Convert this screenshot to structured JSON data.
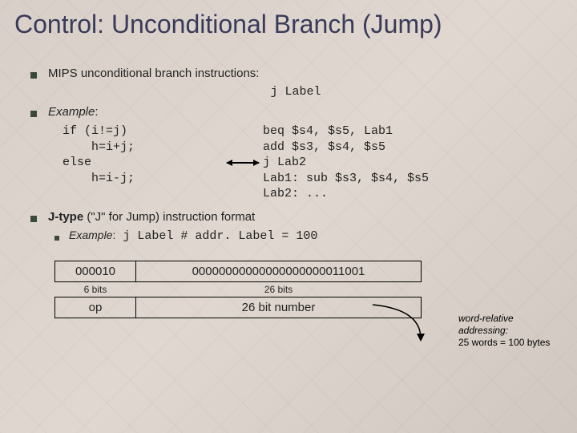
{
  "title": "Control: Unconditional Branch (Jump)",
  "bullets": {
    "b1": "MIPS unconditional branch instructions:",
    "b1_code": "j Label",
    "b2": "Example",
    "b3": "J-type",
    "b3_rest": " (\"J\" for Jump) instruction format",
    "sub": "Example",
    "sub_rest": " j Label # addr. Label = 100"
  },
  "code": {
    "left": "if (i!=j)\n    h=i+j;\nelse\n    h=i-j;",
    "right": "beq $s4, $s5, Lab1\nadd $s3, $s4, $s5\nj Lab2\nLab1: sub $s3, $s4, $s5\nLab2: ..."
  },
  "note": {
    "l1": "word-relative",
    "l2": "addressing",
    "l3": "25 words = 100 bytes"
  },
  "table": {
    "opcode": "000010",
    "address": "00000000000000000000011001",
    "bits_op": "6 bits",
    "bits_addr": "26 bits",
    "label_op": "op",
    "label_addr": "26 bit number"
  }
}
